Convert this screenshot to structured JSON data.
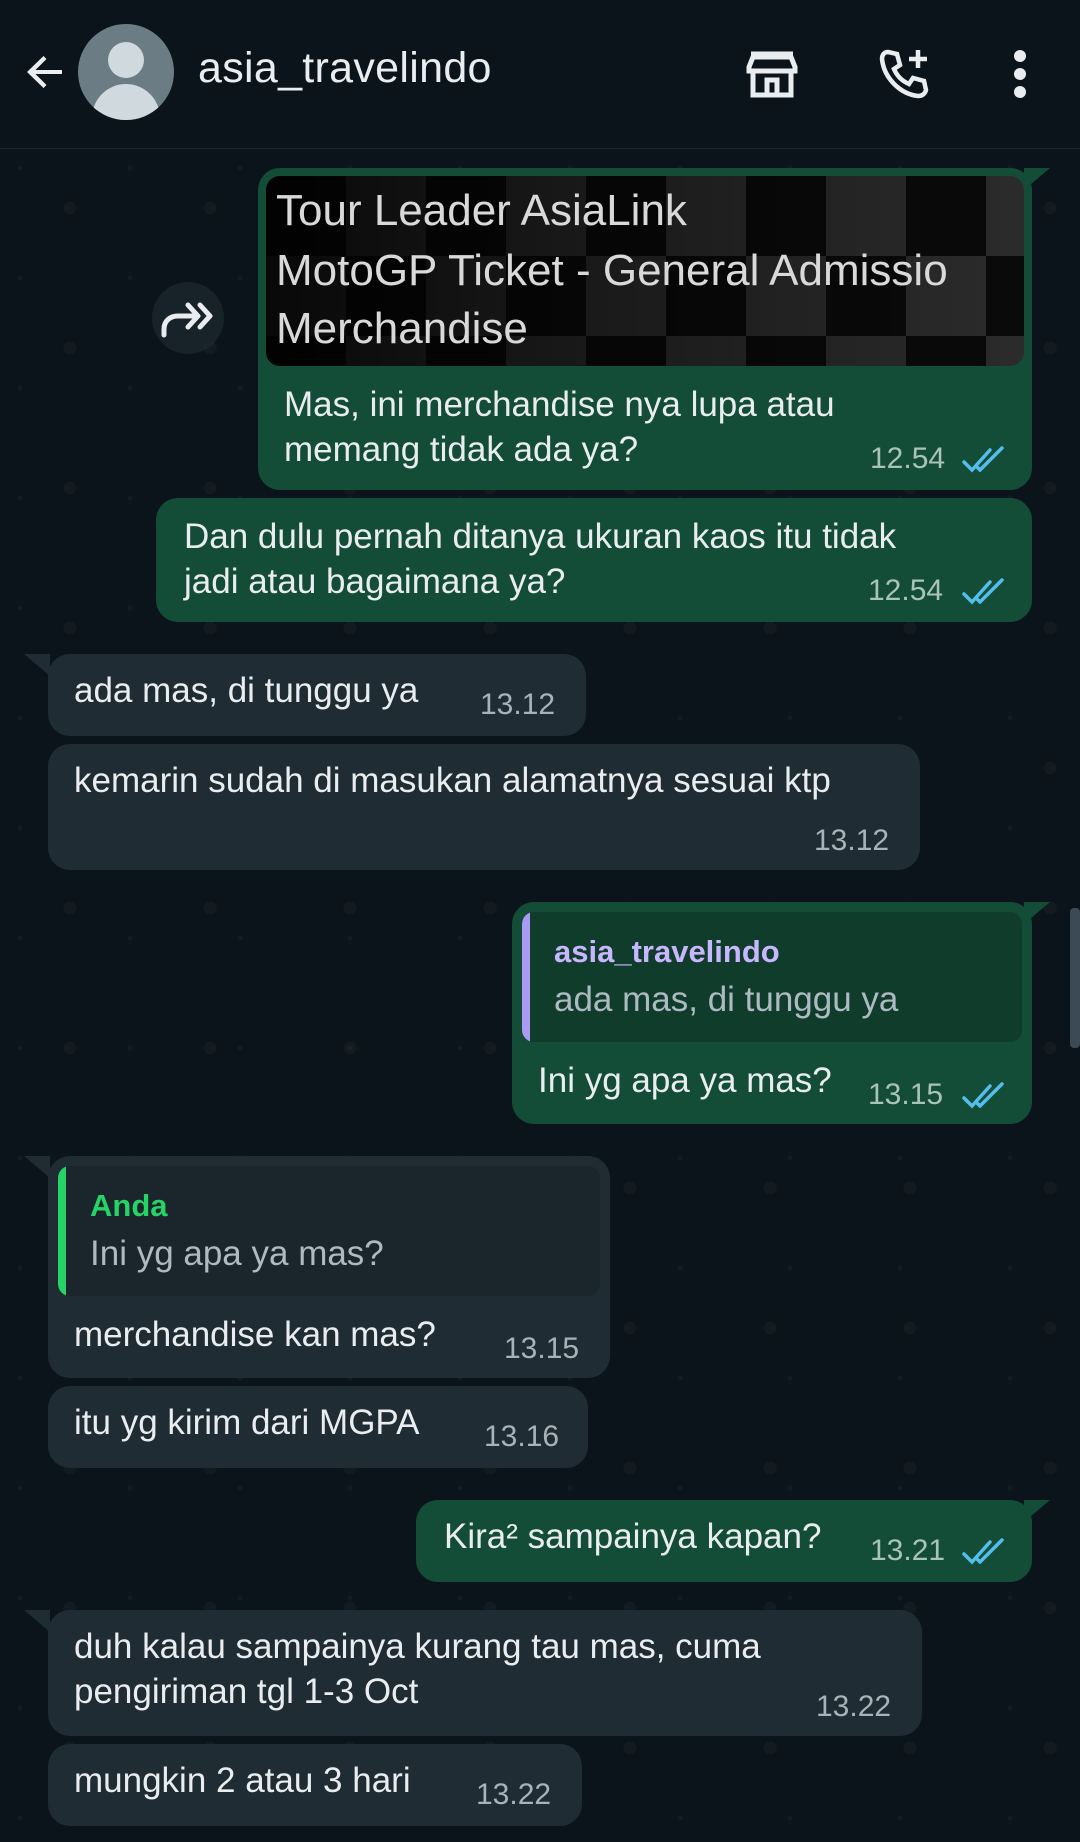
{
  "header": {
    "contact_name": "asia_travelindo",
    "icons": [
      "back-arrow-icon",
      "avatar",
      "store-icon",
      "add-call-icon",
      "more-vertical-icon"
    ]
  },
  "colors": {
    "background": "#0b141a",
    "outgoing_bubble": "#144d37",
    "incoming_bubble": "#202c33",
    "read_ticks": "#53bdeb",
    "quote_bar_contact": "#a99bf3",
    "quote_bar_you": "#25d366"
  },
  "messages": [
    {
      "direction": "out",
      "forwarded_media": true,
      "media_lines": [
        "Tour Leader AsiaLink",
        "MotoGP Ticket - General Admissio",
        "Merchandise"
      ],
      "text": "Mas, ini merchandise nya lupa atau\nmemang tidak ada ya?",
      "time": "12.54",
      "status": "read"
    },
    {
      "direction": "out",
      "text": "Dan dulu pernah ditanya ukuran kaos itu tidak\njadi atau bagaimana ya?",
      "time": "12.54",
      "status": "read"
    },
    {
      "direction": "in",
      "text": "ada mas, di tunggu ya",
      "time": "13.12"
    },
    {
      "direction": "in",
      "text": "kemarin sudah di masukan alamatnya sesuai ktp",
      "time": "13.12"
    },
    {
      "direction": "out",
      "quote": {
        "name": "asia_travelindo",
        "text": "ada mas, di tunggu ya"
      },
      "text": "Ini yg apa ya mas?",
      "time": "13.15",
      "status": "read"
    },
    {
      "direction": "in",
      "quote": {
        "name": "Anda",
        "text": "Ini yg apa ya mas?"
      },
      "text": "merchandise kan mas?",
      "time": "13.15"
    },
    {
      "direction": "in",
      "text": "itu yg kirim dari MGPA",
      "time": "13.16"
    },
    {
      "direction": "out",
      "text": "Kira² sampainya kapan?",
      "time": "13.21",
      "status": "read"
    },
    {
      "direction": "in",
      "text": "duh kalau sampainya kurang tau mas, cuma\npengiriman tgl 1-3 Oct",
      "time": "13.22"
    },
    {
      "direction": "in",
      "text": "mungkin 2 atau 3 hari",
      "time": "13.22"
    }
  ]
}
